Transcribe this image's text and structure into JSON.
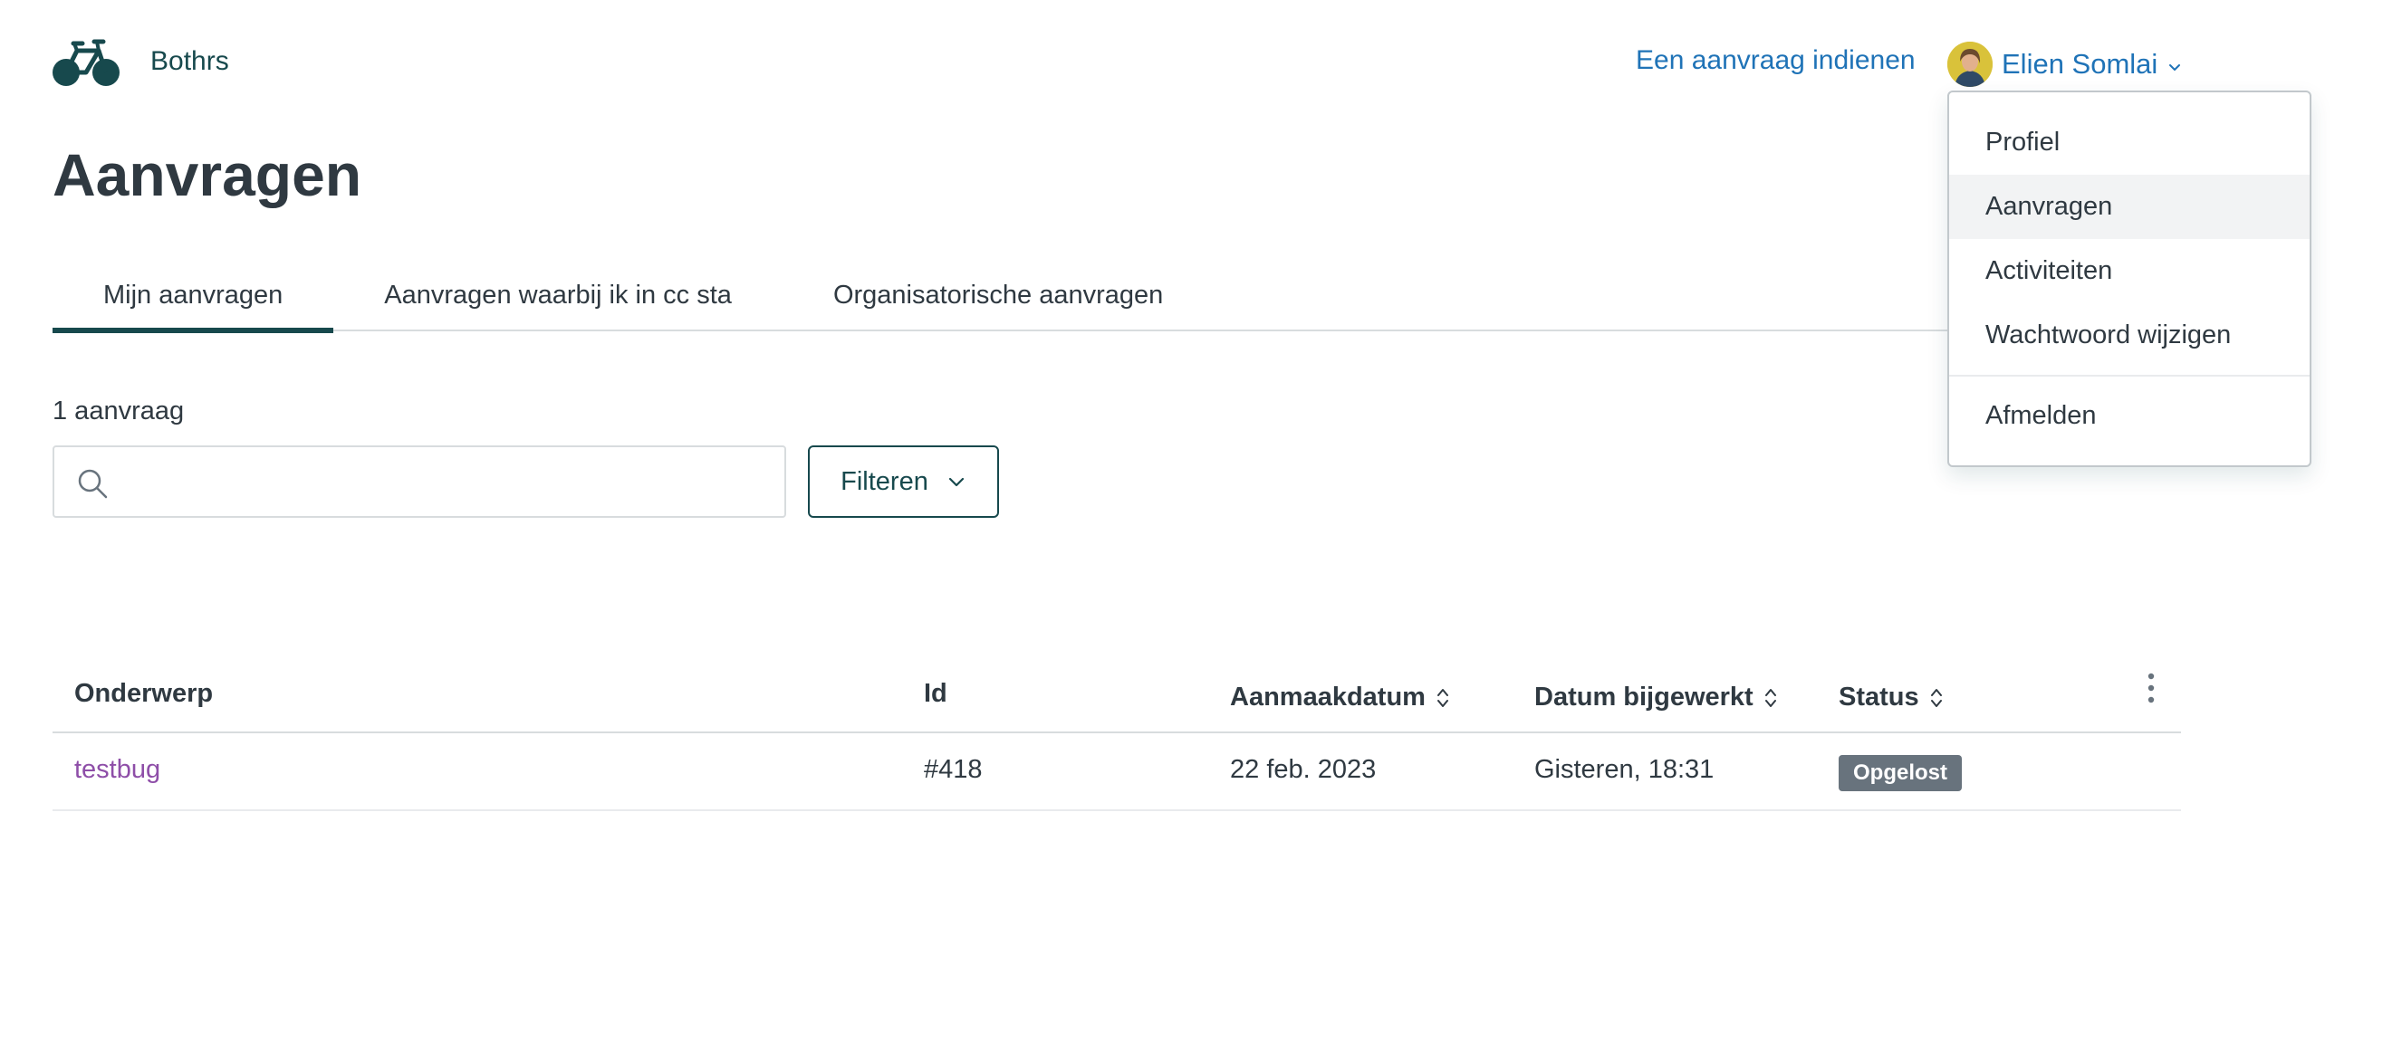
{
  "header": {
    "brand_name": "Bothrs",
    "submit_request_label": "Een aanvraag indienen",
    "user_name": "Elien Somlai"
  },
  "page": {
    "title": "Aanvragen"
  },
  "tabs": [
    {
      "label": "Mijn aanvragen",
      "active": true
    },
    {
      "label": "Aanvragen waarbij ik in cc sta",
      "active": false
    },
    {
      "label": "Organisatorische aanvragen",
      "active": false
    }
  ],
  "results": {
    "count_label": "1 aanvraag",
    "search_placeholder": "",
    "search_value": "",
    "filter_label": "Filteren"
  },
  "table": {
    "columns": [
      "Onderwerp",
      "Id",
      "Aanmaakdatum",
      "Datum bijgewerkt",
      "Status"
    ],
    "rows": [
      {
        "subject": "testbug",
        "id": "#418",
        "created": "22 feb. 2023",
        "updated": "Gisteren, 18:31",
        "status": "Opgelost"
      }
    ]
  },
  "user_menu": {
    "items": [
      "Profiel",
      "Aanvragen",
      "Activiteiten",
      "Wachtwoord wijzigen"
    ],
    "highlighted": "Aanvragen",
    "logout_label": "Afmelden"
  },
  "colors": {
    "brand": "#17494d",
    "link": "#1f73b7",
    "subject_link": "#8e4ea8",
    "status_badge": "#68737d"
  },
  "icons": [
    "bicycle-logo-icon",
    "chevron-down-icon",
    "search-icon",
    "sort-icon",
    "more-vertical-icon"
  ]
}
